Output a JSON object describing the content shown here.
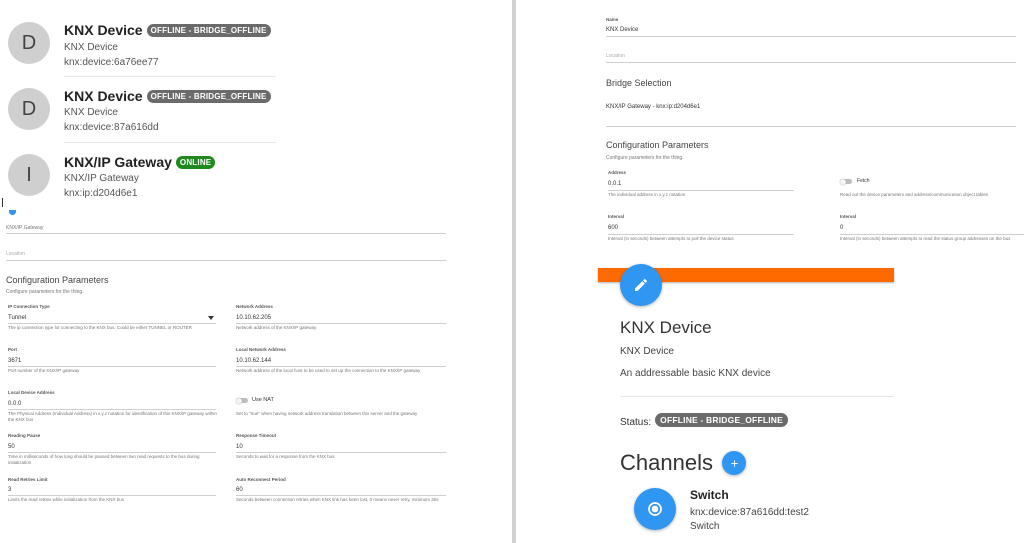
{
  "left": {
    "things": [
      {
        "avatar": "D",
        "title": "KNX Device",
        "badge": "OFFLINE - BRIDGE_OFFLINE",
        "label": "KNX Device",
        "uid": "knx:device:6a76ee77"
      },
      {
        "avatar": "D",
        "title": "KNX Device",
        "badge": "OFFLINE - BRIDGE_OFFLINE",
        "label": "KNX Device",
        "uid": "knx:device:87a616dd"
      },
      {
        "avatar": "I",
        "title": "KNX/IP Gateway",
        "badge": "ONLINE",
        "label": "KNX/IP Gateway",
        "uid": "knx:ip:d204d6e1"
      }
    ],
    "partial_label": "KNX/IP Gateway",
    "location_placeholder": "Location",
    "config": {
      "title": "Configuration Parameters",
      "subtitle": "Configure parameters for the thing.",
      "fields": {
        "ip_connection_type": {
          "label": "IP Connection Type",
          "value": "Tunnel",
          "hint": "The ip connection type for connecting to the KNX bus. Could be either TUNNEL or ROUTER"
        },
        "network_address": {
          "label": "Network Address",
          "value": "10.10.62.205",
          "hint": "Network address of the KNX/IP gateway"
        },
        "port": {
          "label": "Port",
          "value": "3671",
          "hint": "Port number of the KNX/IP gateway"
        },
        "local_network_address": {
          "label": "Local Network Address",
          "value": "10.10.62.144",
          "hint": "Network address of the local host to be used to set up the connection to the KNX/IP gateway"
        },
        "local_device_address": {
          "label": "Local Device Address",
          "value": "0.0.0",
          "hint": "The Physical Address (Individual Address) in x.y.z notation for identification of this KNX/IP gateway within the KNX bus"
        },
        "use_nat": {
          "label": "Use NAT",
          "hint": "Set to \"true\" when having network address translation between this server and the gateway"
        },
        "reading_pause": {
          "label": "Reading Pause",
          "value": "50",
          "hint": "Time in milliseconds of how long should be paused between two read requests to the bus during initialization"
        },
        "response_timeout": {
          "label": "Response Timeout",
          "value": "10",
          "hint": "Seconds to wait for a response from the KNX bus"
        },
        "read_retries_limit": {
          "label": "Read Retries Limit",
          "value": "3",
          "hint": "Limits the read retries while initialization from the KNX bus"
        },
        "auto_reconnect_period": {
          "label": "Auto Reconnect Period",
          "value": "60",
          "hint": "Seconds between connection retries when KNX link has been lost, 0 means never retry, minimum 30s"
        }
      }
    }
  },
  "right": {
    "name_label": "Name",
    "name_value": "KNX Device",
    "location_placeholder": "Location",
    "bridge_title": "Bridge Selection",
    "bridge_value": "KNX/IP Gateway - knx:ip:d204d6e1",
    "config": {
      "title": "Configuration Parameters",
      "subtitle": "Configure parameters for the thing.",
      "fields": {
        "address": {
          "label": "Address",
          "value": "0.0.1",
          "hint": "The individual address in x.y.z notation"
        },
        "fetch": {
          "label": "Fetch",
          "hint": "Read out the device parameters and address/communication object tables"
        },
        "interval1": {
          "label": "Interval",
          "value": "600",
          "hint": "Interval (in seconds) between attempts to poll the device status"
        },
        "interval2": {
          "label": "Interval",
          "value": "0",
          "hint": "Interval (in seconds) between attempts to read the status group addresses on the bus"
        }
      }
    },
    "device": {
      "title": "KNX Device",
      "label": "KNX Device",
      "description": "An addressable basic KNX device",
      "status_label": "Status:",
      "status_badge": "OFFLINE - BRIDGE_OFFLINE"
    },
    "channels_title": "Channels",
    "channel": {
      "name": "Switch",
      "uid": "knx:device:87a616dd:test2",
      "type": "Switch"
    }
  },
  "colors": {
    "accent_orange": "#ff6a00",
    "fab_blue": "#2f96f2",
    "badge_offline": "#6b6b6b",
    "badge_online": "#1e8a1e"
  }
}
